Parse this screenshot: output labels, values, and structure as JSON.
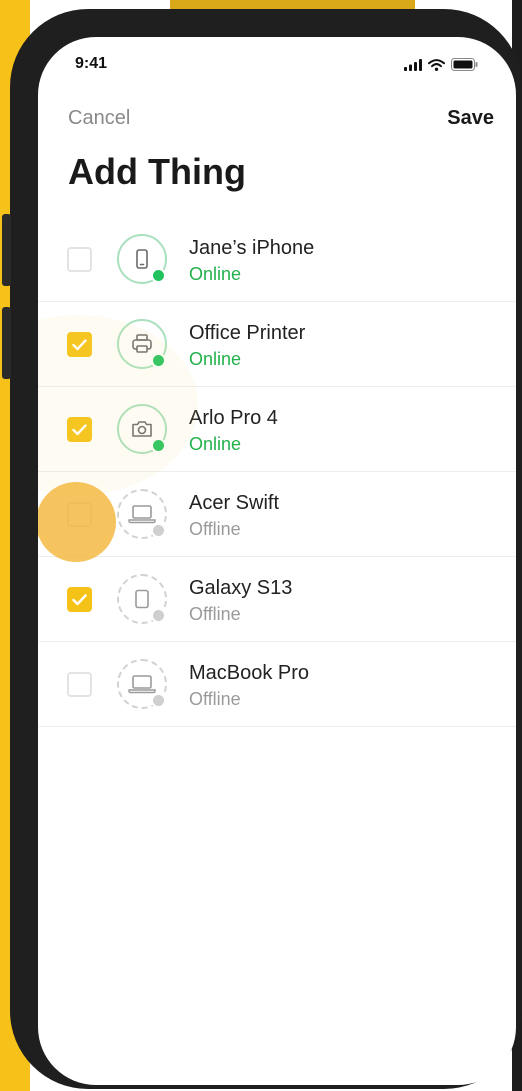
{
  "status_bar": {
    "time": "9:41",
    "icons": [
      "signal-icon",
      "wifi-icon",
      "battery-icon"
    ]
  },
  "nav": {
    "cancel_label": "Cancel",
    "save_label": "Save"
  },
  "page": {
    "title": "Add Thing"
  },
  "colors": {
    "accent": "#F5C318",
    "online": "#22C35E",
    "offline": "#9A9A9A",
    "background_accent": "#F6C21A"
  },
  "devices": [
    {
      "name": "Jane’s iPhone",
      "status": "Online",
      "checked": false,
      "icon": "phone-icon"
    },
    {
      "name": "Office Printer",
      "status": "Online",
      "checked": true,
      "icon": "printer-icon"
    },
    {
      "name": "Arlo Pro 4",
      "status": "Online",
      "checked": true,
      "icon": "camera-icon"
    },
    {
      "name": "Acer Swift",
      "status": "Offline",
      "checked": false,
      "icon": "laptop-icon"
    },
    {
      "name": "Galaxy S13",
      "status": "Offline",
      "checked": true,
      "icon": "tablet-icon"
    },
    {
      "name": "MacBook Pro",
      "status": "Offline",
      "checked": false,
      "icon": "laptop-icon"
    }
  ]
}
